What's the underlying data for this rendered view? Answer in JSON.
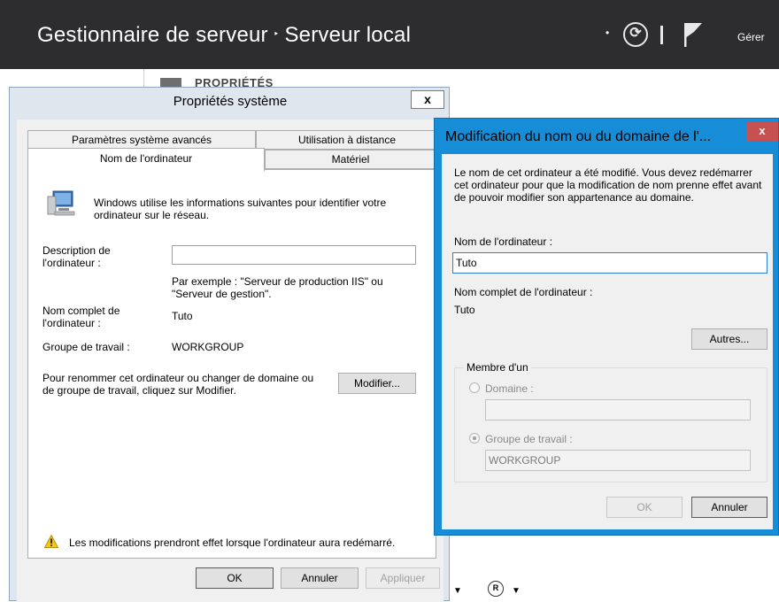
{
  "server_manager": {
    "breadcrumb_root": "Gestionnaire de serveur",
    "breadcrumb_separator": "‣",
    "breadcrumb_current": "Serveur local",
    "dropdown_glyph": "•",
    "refresh_glyph": "⟳",
    "manage_label": "Gérer",
    "properties_heading": "PROPRIÉTÉS",
    "icons": [
      "refresh-icon",
      "flag-icon",
      "roles-icon"
    ]
  },
  "system_properties": {
    "title": "Propriétés système",
    "close_glyph": "x",
    "tabs": {
      "advanced": "Paramètres système avancés",
      "remote": "Utilisation à distance",
      "computer_name": "Nom de l'ordinateur",
      "hardware": "Matériel"
    },
    "intro_text": "Windows utilise les informations suivantes pour identifier votre ordinateur sur le réseau.",
    "description_label": "Description de l'ordinateur :",
    "description_value": "",
    "description_example": "Par exemple : \"Serveur de production IIS\" ou \"Serveur de gestion\".",
    "full_name_label": "Nom complet de l'ordinateur :",
    "full_name_value": "Tuto",
    "workgroup_label": "Groupe de travail :",
    "workgroup_value": "WORKGROUP",
    "rename_text": "Pour renommer cet ordinateur ou changer de domaine ou de groupe de travail, cliquez sur Modifier.",
    "modify_button": "Modifier...",
    "warning_text": "Les modifications prendront effet lorsque l'ordinateur aura redémarré.",
    "ok_button": "OK",
    "cancel_button": "Annuler",
    "apply_button": "Appliquer"
  },
  "rename_dialog": {
    "title": "Modification du nom ou du domaine de l'...",
    "close_glyph": "x",
    "message": "Le nom de cet ordinateur a été modifié. Vous devez redémarrer cet ordinateur pour que la modification de nom prenne effet avant de pouvoir modifier son appartenance au domaine.",
    "computer_name_label": "Nom de l'ordinateur :",
    "computer_name_value": "Tuto",
    "full_name_label": "Nom complet de l'ordinateur :",
    "full_name_value": "Tuto",
    "more_button": "Autres...",
    "member_of_label": "Membre d'un",
    "domain_label": "Domaine :",
    "domain_value": "",
    "workgroup_label": "Groupe de travail :",
    "workgroup_value": "WORKGROUP",
    "selected_option": "workgroup",
    "ok_button": "OK",
    "cancel_button": "Annuler"
  },
  "colors": {
    "header_bg": "#2d2d2f",
    "dialog_accent": "#168dd6",
    "close_red": "#c75050"
  }
}
